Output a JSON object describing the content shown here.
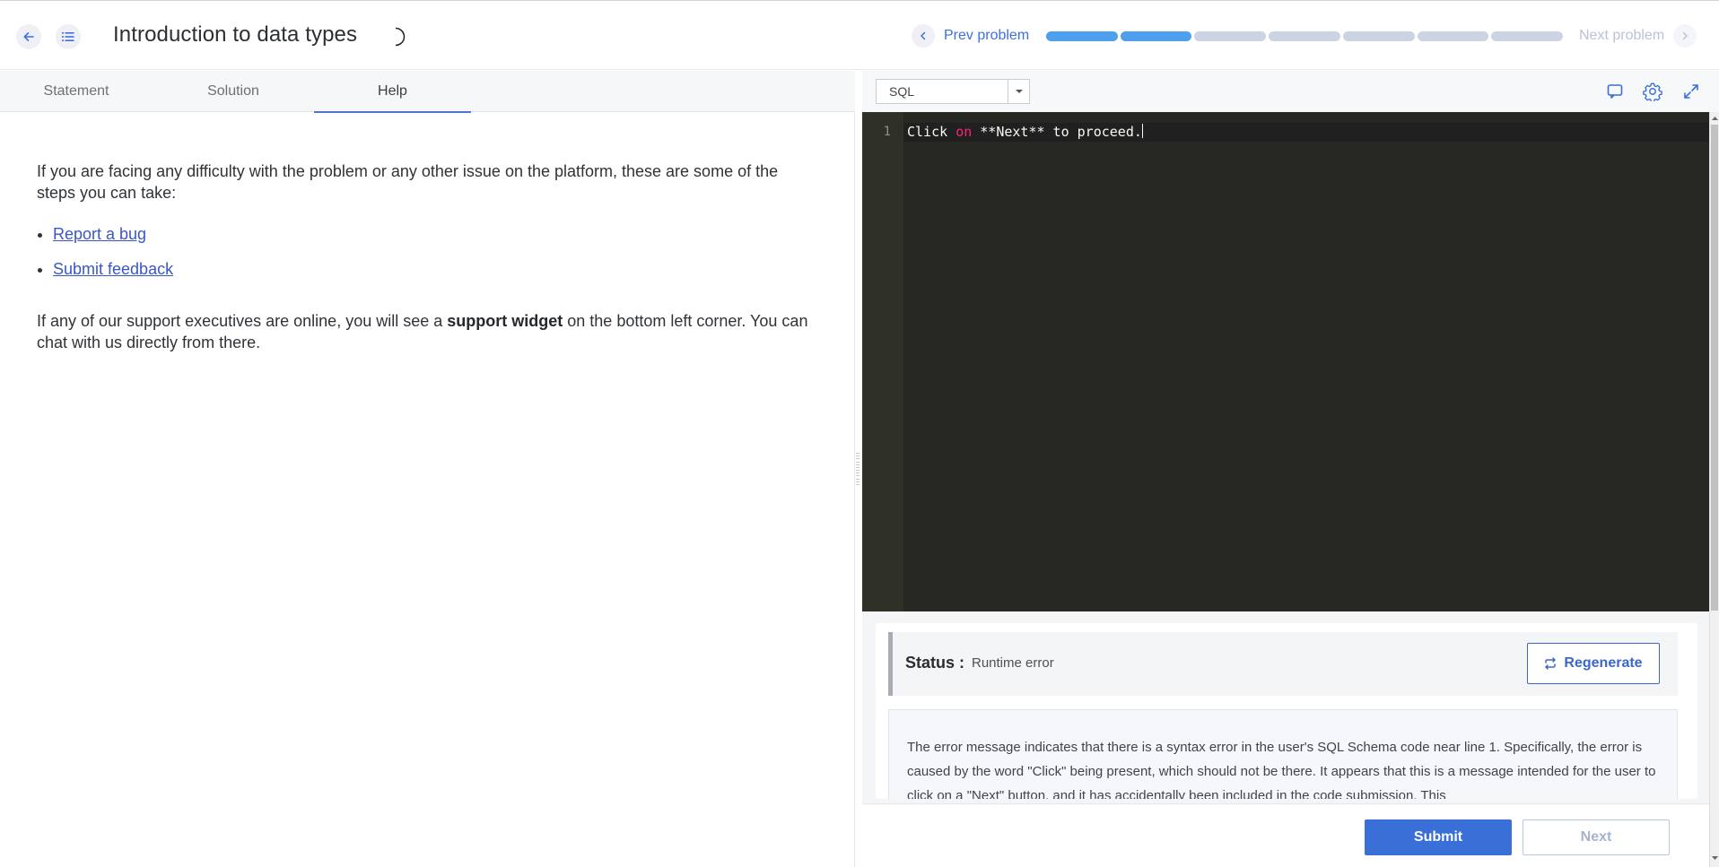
{
  "header": {
    "title": "Introduction to data types",
    "prev_label": "Prev problem",
    "next_label": "Next problem",
    "progress": {
      "total": 7,
      "completed": 2
    }
  },
  "tabs": [
    {
      "label": "Statement",
      "active": false
    },
    {
      "label": "Solution",
      "active": false
    },
    {
      "label": "Help",
      "active": true
    }
  ],
  "help": {
    "intro": "If you are facing any difficulty with the problem or any other issue on the platform, these are some of the steps you can take:",
    "links": [
      "Report a bug",
      "Submit feedback"
    ],
    "support_prefix": "If any of our support executives are online, you will see a ",
    "support_bold": "support widget",
    "support_suffix": " on the bottom left corner. You can chat with us directly from there."
  },
  "editor": {
    "language": "SQL",
    "line_number": "1",
    "code_before": "Click ",
    "code_keyword": "on",
    "code_after": " **Next** to proceed."
  },
  "status": {
    "label": "Status :",
    "value": "Runtime error",
    "regenerate_label": "Regenerate",
    "message": "The error message indicates that there is a syntax error in the user's SQL Schema code near line 1. Specifically, the error is caused by the word \"Click\" being present, which should not be there. It appears that this is a message intended for the user to click on a \"Next\" button, and it has accidentally been included in the code submission. This"
  },
  "footer": {
    "submit_label": "Submit",
    "next_label": "Next"
  },
  "colors": {
    "accent": "#3a6fd8",
    "progress_done": "#4ea0ef",
    "progress_todo": "#ccd3e3",
    "editor_bg": "#272822",
    "keyword": "#f92672"
  },
  "icons": [
    "back-arrow-icon",
    "list-icon",
    "theme-toggle-icon",
    "chevron-left-icon",
    "chevron-right-icon",
    "caret-down-icon",
    "chat-icon",
    "gear-icon",
    "expand-icon",
    "refresh-icon"
  ]
}
